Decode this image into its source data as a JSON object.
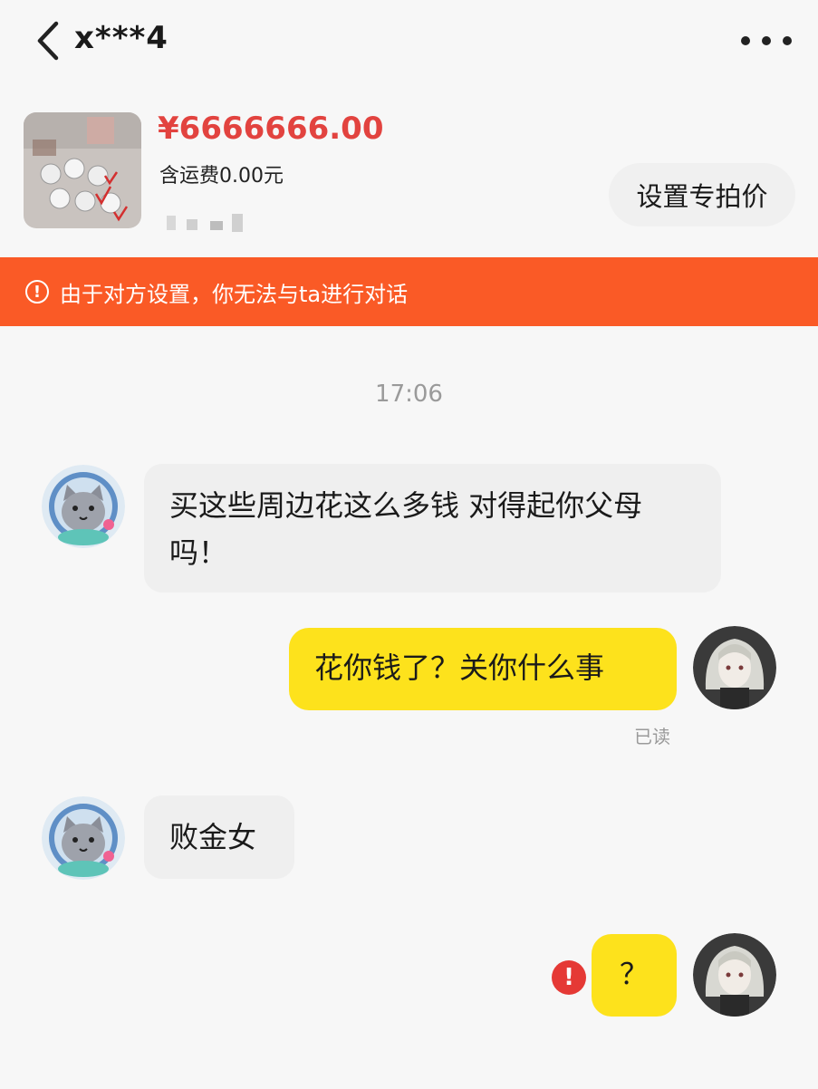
{
  "header": {
    "title": "x***4"
  },
  "product": {
    "price": "¥6666666.00",
    "shipping": "含运费0.00元",
    "set_price_label": "设置专拍价"
  },
  "warning": {
    "text": "由于对方设置，你无法与ta进行对话"
  },
  "chat": {
    "timestamp": "17:06",
    "messages": [
      {
        "side": "in",
        "text": "买这些周边花这么多钱 对得起你父母吗！"
      },
      {
        "side": "out",
        "text": "花你钱了？关你什么事",
        "status": "已读"
      },
      {
        "side": "in",
        "text": "败金女"
      },
      {
        "side": "out",
        "text": "？",
        "failed": true
      }
    ]
  },
  "colors": {
    "accent_price": "#e2433f",
    "warning_bar": "#fa5a26",
    "outgoing_bubble": "#fde21c",
    "incoming_bubble": "#efefef"
  },
  "icons": [
    "back-chevron-icon",
    "more-dots-icon",
    "info-circle-icon",
    "error-icon"
  ]
}
